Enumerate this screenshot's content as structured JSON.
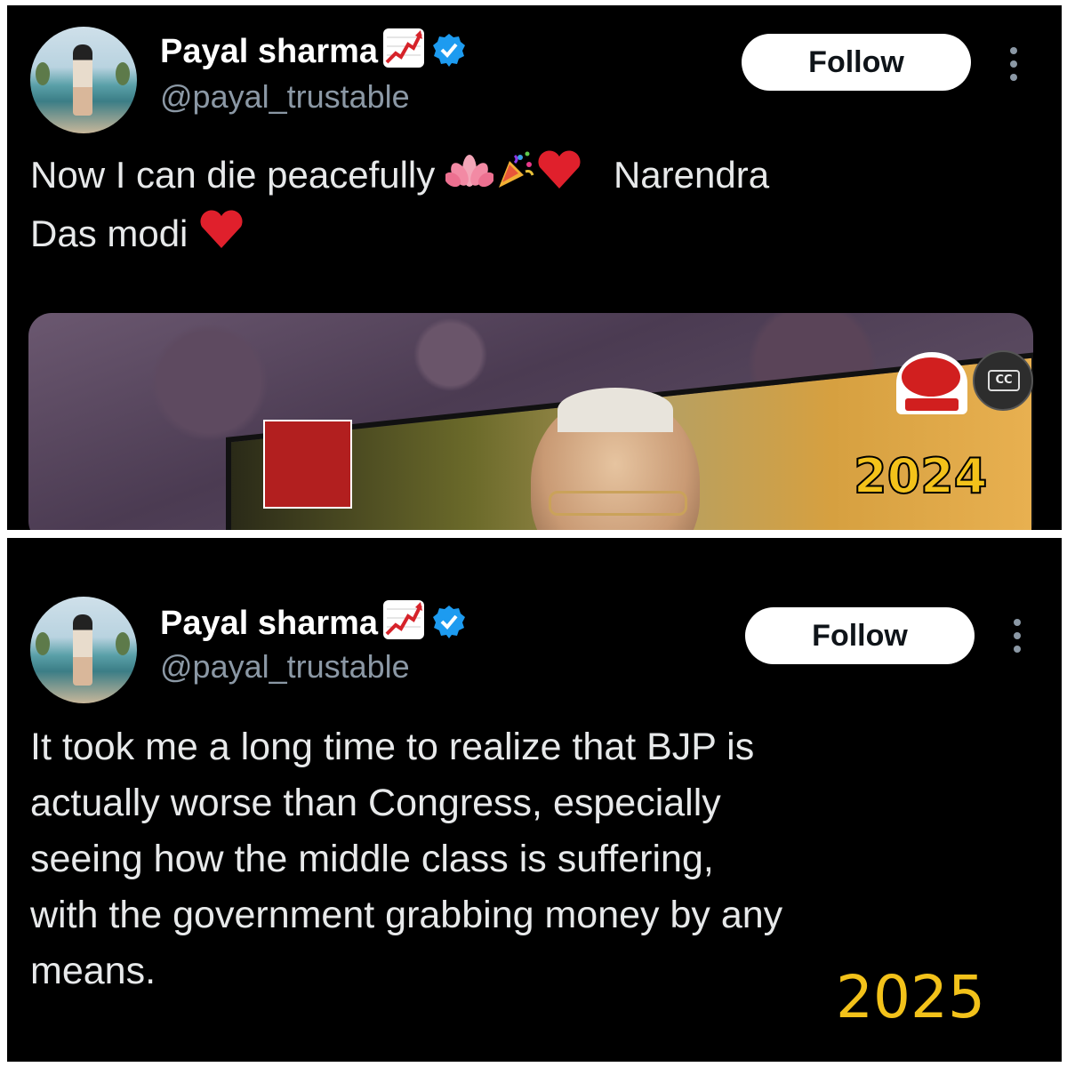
{
  "top_tweet": {
    "author": {
      "name": "Payal sharma",
      "handle": "@payal_trustable",
      "avatar_icon": "profile-photo",
      "badge_icon": "verified-checkmark-icon",
      "badge_color": "#1d9bf0",
      "emoji_icon": "chart-increasing-emoji"
    },
    "follow_label": "Follow",
    "text_main": "Now I can die peacefully",
    "text_after_emojis": "Narendra",
    "text_line2": "Das modi",
    "emojis": [
      "lotus-emoji",
      "party-popper-emoji",
      "red-heart-emoji",
      "red-heart-emoji"
    ],
    "media": {
      "channel_logo": "aaj-tak-live-logo",
      "cc_label": "CC",
      "year_label": "2024"
    }
  },
  "bottom_tweet": {
    "author": {
      "name": "Payal sharma",
      "handle": "@payal_trustable",
      "avatar_icon": "profile-photo",
      "badge_icon": "verified-checkmark-icon",
      "badge_color": "#1d9bf0",
      "emoji_icon": "chart-increasing-emoji"
    },
    "follow_label": "Follow",
    "text_lines": [
      "It took me a long time to realize that BJP is",
      "actually worse than Congress, especially",
      "seeing how the middle class is suffering,",
      "with the government grabbing money by any",
      "means."
    ],
    "year_label": "2025"
  },
  "colors": {
    "background": "#000000",
    "text": "#e7e9ea",
    "secondary_text": "#8b98a5",
    "year_label": "#f3c21a"
  }
}
